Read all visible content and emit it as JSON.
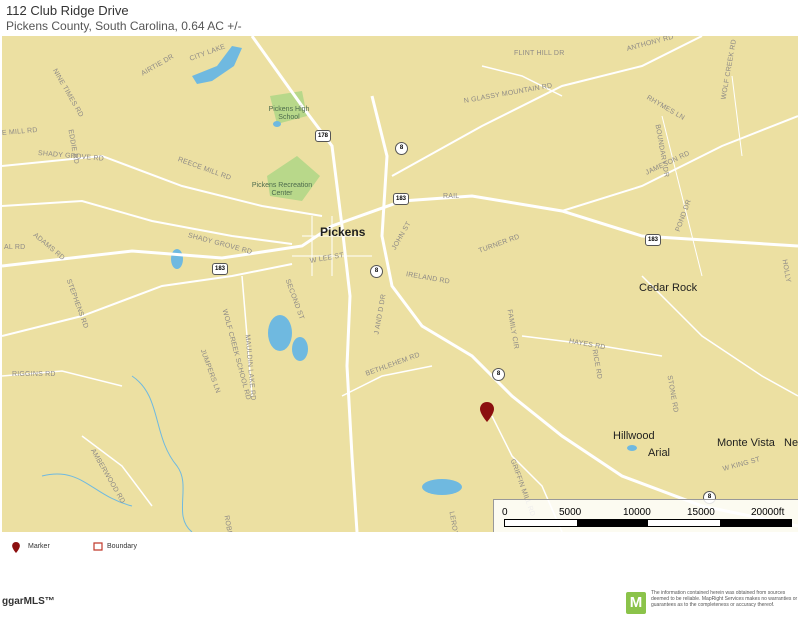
{
  "header": {
    "title": "112 Club Ridge Drive",
    "subtitle": "Pickens County, South Carolina, 0.64 AC +/-"
  },
  "colors": {
    "land": "#ece0a2",
    "road": "#ffffff",
    "water": "#6fb9e0",
    "park": "#b8d88a",
    "marker": "#8b0f0f"
  },
  "map": {
    "towns": {
      "pickens": "Pickens",
      "cedar_rock": "Cedar Rock",
      "hillwood": "Hillwood",
      "monte_vista": "Monte Vista",
      "arial": "Arial",
      "ne": "Ne"
    },
    "pois": {
      "high_school": "Pickens High School",
      "recreation_center": "Pickens Recreation Center"
    },
    "roads": {
      "city_lake": "CITY LAKE",
      "airtie_dr": "AIRTIE DR",
      "nine_times_rd": "NINE TIMES RD",
      "reece_mill_rd_1": "E MILL RD",
      "eddie_rd": "EDDIE RD",
      "shady_grove_rd_1": "SHADY GROVE RD",
      "reece_mill_rd_2": "REECE MILL RD",
      "shady_grove_rd_2": "SHADY GROVE RD",
      "adams_rd": "ADAMS RD",
      "stephens_rd": "STEPHENS RD",
      "al_rd": "AL RD",
      "riggins_rd": "RIGGINS RD",
      "jumpers_ln": "JUMPERS LN",
      "wolf_creek_school_rd": "WOLF CREEK SCHOOL RD",
      "mauldin_lake_rd": "MAULDIN LAKE RD",
      "second_st": "SECOND ST",
      "w_lee_st": "W LEE ST",
      "john_st": "JOHN ST",
      "ireland_rd": "IRELAND RD",
      "turner_rd": "TURNER RD",
      "bethlehem_rd": "BETHLEHEM RD",
      "j_and_d_dr": "J AND D DR",
      "flint_hill_dr": "FLINT HILL DR",
      "anthony_rd": "ANTHONY RD",
      "n_glassy_mountain_rd": "N GLASSY MOUNTAIN RD",
      "rhymes_ln": "RHYMES LN",
      "boundary_dr": "BOUNDARY DR",
      "wolf_creek_rd": "WOLF CREEK RD",
      "jameson_rd": "JAMESON RD",
      "pond_dr": "POND DR",
      "holly": "HOLLY",
      "rail": "RAIL",
      "family_cir": "FAMILY CIR",
      "hayes_rd": "HAYES RD",
      "rice_rd": "RICE RD",
      "stone_rd": "STONE RD",
      "griffin_mill_rd": "GRIFFIN MILL RD",
      "w_king_st": "W KING ST",
      "amberwood_rd": "AMBERWOOD RD",
      "robin": "ROBIN",
      "leroy": "LEROY"
    },
    "shields": {
      "us178": "178",
      "sc8_a": "8",
      "us183_a": "183",
      "us183_b": "183",
      "sc8_b": "8",
      "us183_c": "183",
      "sc8_c": "8",
      "sc8_d": "8"
    },
    "scale": {
      "ticks": [
        "0",
        "5000",
        "10000",
        "15000",
        "20000ft"
      ],
      "max_ft": 20000
    }
  },
  "legend": {
    "marker_label": "Marker",
    "boundary_label": "Boundary"
  },
  "footer": {
    "logo_text": "ggarMLS™",
    "badge_letter": "M",
    "disclaimer": "The information contained herein was obtained from sources deemed to be reliable. MapRight Services makes no warranties or guarantees as to the completeness or accuracy thereof."
  }
}
